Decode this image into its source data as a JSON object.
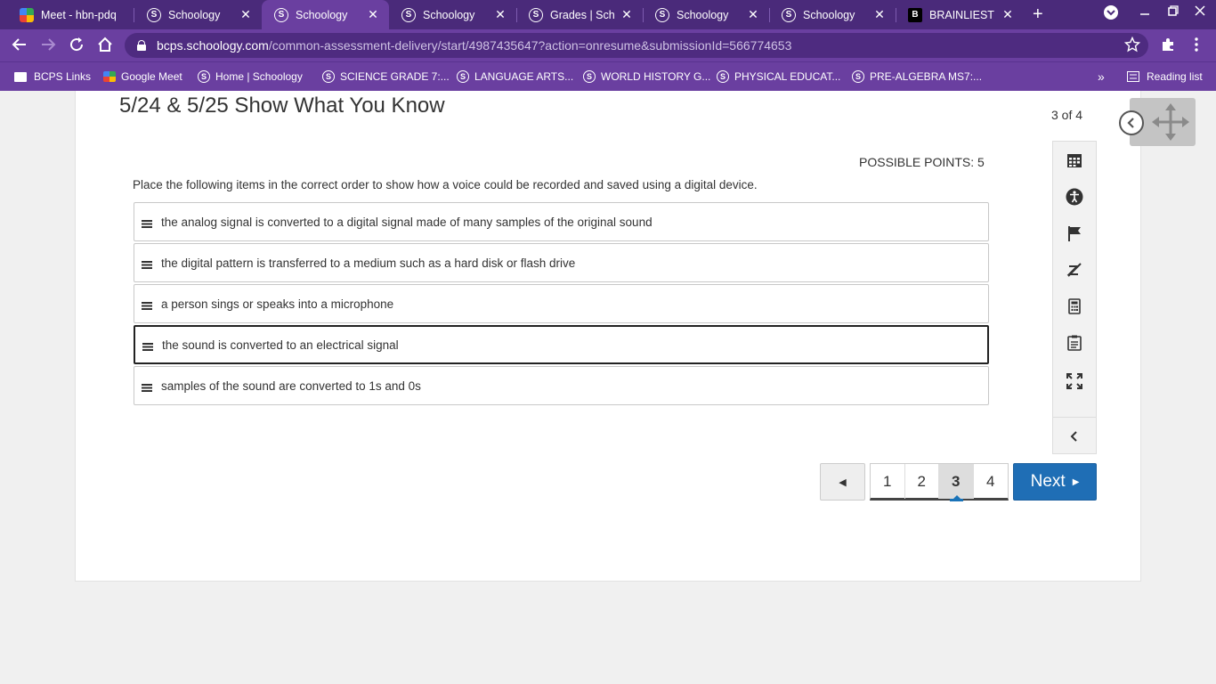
{
  "browser": {
    "tabs": [
      {
        "title": "Meet - hbn-pdq",
        "icon": "meet-icon",
        "active": false
      },
      {
        "title": "Schoology",
        "icon": "schoology-icon",
        "active": false
      },
      {
        "title": "Schoology",
        "icon": "schoology-icon",
        "active": true
      },
      {
        "title": "Schoology",
        "icon": "schoology-icon",
        "active": false
      },
      {
        "title": "Grades | Schoology",
        "icon": "schoology-icon",
        "active": false
      },
      {
        "title": "Schoology",
        "icon": "schoology-icon",
        "active": false
      },
      {
        "title": "Schoology",
        "icon": "schoology-icon",
        "active": false
      },
      {
        "title": "BRAINLIEST IF",
        "icon": "brainly-icon",
        "active": false
      }
    ],
    "url_host": "bcps.schoology.com",
    "url_path": "/common-assessment-delivery/start/4987435647?action=onresume&submissionId=566774653",
    "bookmarks": [
      {
        "label": "BCPS Links",
        "icon": "folder-icon"
      },
      {
        "label": "Google Meet",
        "icon": "meet-icon"
      },
      {
        "label": "Home | Schoology",
        "icon": "schoology-icon"
      },
      {
        "label": "SCIENCE GRADE 7:...",
        "icon": "schoology-icon"
      },
      {
        "label": "LANGUAGE ARTS...",
        "icon": "schoology-icon"
      },
      {
        "label": "WORLD HISTORY G...",
        "icon": "schoology-icon"
      },
      {
        "label": "PHYSICAL EDUCAT...",
        "icon": "schoology-icon"
      },
      {
        "label": "PRE-ALGEBRA MS7:...",
        "icon": "schoology-icon"
      }
    ],
    "reading_list": "Reading list",
    "overflow": "»"
  },
  "assessment": {
    "title": "5/24 & 5/25 Show What You Know",
    "counter": "3 of 4",
    "points": "POSSIBLE POINTS: 5",
    "prompt": "Place the following items in the correct order to show how a voice could be recorded and saved using a digital device.",
    "items": [
      "the analog signal is converted to a digital signal made of many samples of the original sound",
      "the digital pattern is transferred to a medium such as a hard disk or flash drive",
      "a person sings or speaks into a microphone",
      "the sound is converted to an electrical signal",
      "samples of the sound are converted to 1s and 0s"
    ]
  },
  "pagination": {
    "prev": "◀",
    "pages": [
      "1",
      "2",
      "3",
      "4"
    ],
    "current": "3",
    "next": "Next",
    "next_arrow": "▶"
  },
  "colors": {
    "chrome": "#6a3fa0",
    "tabbar": "#4a2a7a",
    "next_button": "#1f6eb5"
  }
}
